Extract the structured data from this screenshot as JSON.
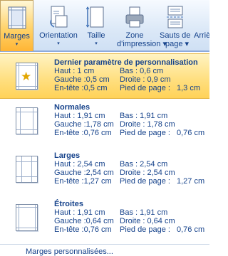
{
  "ribbon": {
    "marges": {
      "label": "Marges",
      "arrow": "▾",
      "icon": "margins-icon"
    },
    "orientation": {
      "label": "Orientation",
      "arrow": "▾",
      "icon": "orientation-icon"
    },
    "taille": {
      "label": "Taille",
      "arrow": "▾",
      "icon": "size-icon"
    },
    "zone": {
      "label1": "Zone",
      "label2": "d'impression ▾",
      "icon": "print-area-icon"
    },
    "sauts": {
      "label1": "Sauts de",
      "label2": "page ▾",
      "icon": "page-break-icon",
      "label_extra": "Arriè"
    }
  },
  "menu": {
    "presets": [
      {
        "title": "Dernier paramètre de personnalisation",
        "rows": [
          [
            "Haut :   1 cm",
            "Bas :     0,6 cm",
            ""
          ],
          [
            "Gauche :0,5 cm",
            "Droite :  0,9 cm",
            ""
          ],
          [
            "En-tête :0,5 cm",
            "Pied de page :",
            "1,3 cm"
          ]
        ]
      },
      {
        "title": "Normales",
        "rows": [
          [
            "Haut :   1,91 cm",
            "Bas :     1,91 cm",
            ""
          ],
          [
            "Gauche :1,78 cm",
            "Droite :  1,78 cm",
            ""
          ],
          [
            "En-tête :0,76 cm",
            "Pied de page :",
            "0,76 cm"
          ]
        ]
      },
      {
        "title": "Larges",
        "rows": [
          [
            "Haut :   2,54 cm",
            "Bas :     2,54 cm",
            ""
          ],
          [
            "Gauche :2,54 cm",
            "Droite :  2,54 cm",
            ""
          ],
          [
            "En-tête :1,27 cm",
            "Pied de page :",
            "1,27 cm"
          ]
        ]
      },
      {
        "title": "Étroites",
        "rows": [
          [
            "Haut :   1,91 cm",
            "Bas :     1,91 cm",
            ""
          ],
          [
            "Gauche :0,64 cm",
            "Droite :  0,64 cm",
            ""
          ],
          [
            "En-tête :0,76 cm",
            "Pied de page :",
            "0,76 cm"
          ]
        ]
      }
    ],
    "custom_label": "Marges personnalisées..."
  },
  "colors": {
    "accent_text": "#15428b",
    "highlight": "#ffd258",
    "ribbon_bg": "#dbe8f7"
  }
}
